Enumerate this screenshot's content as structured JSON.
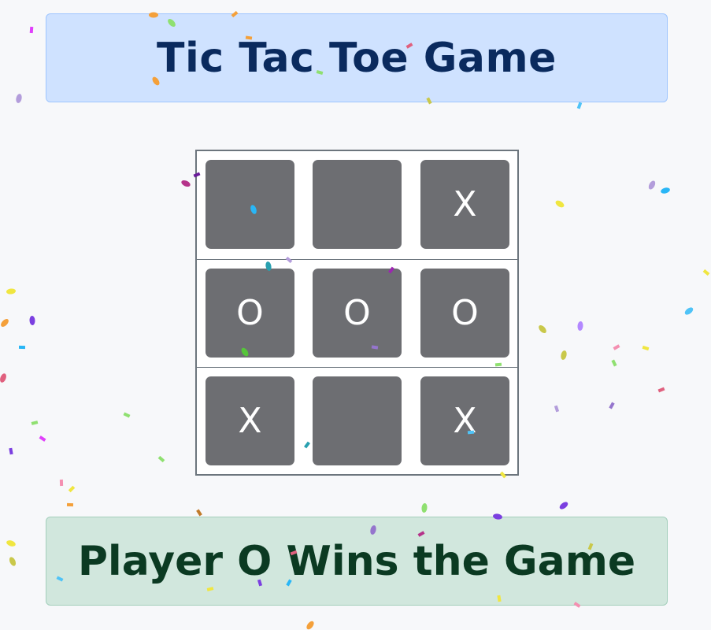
{
  "title": "Tic Tac Toe Game",
  "status": "Player O Wins the Game",
  "board": [
    [
      "",
      "",
      "X"
    ],
    [
      "O",
      "O",
      "O"
    ],
    [
      "X",
      "",
      "X"
    ]
  ],
  "colors": {
    "background": "#f7f8fa",
    "title_bg": "#cfe2ff",
    "title_text": "#0a2a5e",
    "status_bg": "#d1e7dd",
    "status_text": "#0b3a22",
    "cell_bg": "#6d6e72",
    "mark_text": "#ffffff"
  },
  "effects": {
    "confetti": true
  }
}
